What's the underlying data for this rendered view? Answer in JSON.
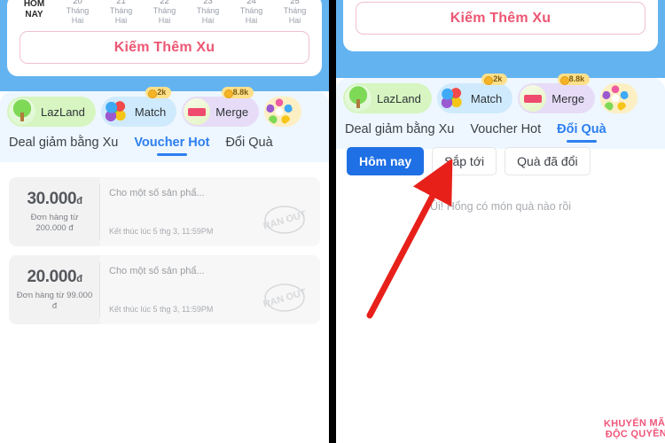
{
  "left_panel": {
    "date_strip": {
      "today_label_line1": "HÔM",
      "today_label_line2": "NAY",
      "dates": [
        {
          "num": "20",
          "month_line1": "Tháng",
          "month_line2": "Hai"
        },
        {
          "num": "21",
          "month_line1": "Tháng",
          "month_line2": "Hai"
        },
        {
          "num": "22",
          "month_line1": "Tháng",
          "month_line2": "Hai"
        },
        {
          "num": "23",
          "month_line1": "Tháng",
          "month_line2": "Hai"
        },
        {
          "num": "24",
          "month_line1": "Tháng",
          "month_line2": "Hai"
        },
        {
          "num": "25",
          "month_line1": "Tháng",
          "month_line2": "Hai"
        }
      ]
    },
    "earn_button_label": "Kiếm Thêm Xu",
    "games": [
      {
        "label": "LazLand",
        "icon": "tree-icon",
        "badge": null
      },
      {
        "label": "Match",
        "icon": "balls-icon",
        "badge": "2k"
      },
      {
        "label": "Merge",
        "icon": "merge-icon",
        "badge": "8.8k"
      },
      {
        "label": "",
        "icon": "flower-icon",
        "badge": null
      }
    ],
    "tabs": [
      {
        "label": "Deal giảm bằng Xu",
        "active": false
      },
      {
        "label": "Voucher Hot",
        "active": true
      },
      {
        "label": "Đổi Quà",
        "active": false
      }
    ],
    "vouchers": [
      {
        "amount": "30.000",
        "currency": "đ",
        "condition_line1": "Đơn hàng từ",
        "condition_line2": "200.000 đ",
        "title": "Cho một số sản phẩ...",
        "expiry": "Kết thúc lúc 5 thg 3, 11:59PM",
        "stamp": "RAN OUT"
      },
      {
        "amount": "20.000",
        "currency": "đ",
        "condition_line1": "Đơn hàng từ 99.000",
        "condition_line2": "đ",
        "title": "Cho một số sản phẩ...",
        "expiry": "Kết thúc lúc 5 thg 3, 11:59PM",
        "stamp": "RAN OUT"
      }
    ]
  },
  "right_panel": {
    "earn_button_label": "Kiếm Thêm Xu",
    "games": [
      {
        "label": "LazLand",
        "icon": "tree-icon",
        "badge": null
      },
      {
        "label": "Match",
        "icon": "balls-icon",
        "badge": "2k"
      },
      {
        "label": "Merge",
        "icon": "merge-icon",
        "badge": "8.8k"
      },
      {
        "label": "",
        "icon": "flower-icon",
        "badge": null
      }
    ],
    "tabs": [
      {
        "label": "Deal giảm bằng Xu",
        "active": false
      },
      {
        "label": "Voucher Hot",
        "active": false
      },
      {
        "label": "Đổi Quà",
        "active": true
      }
    ],
    "subtabs": [
      {
        "label": "Hôm nay",
        "active": true
      },
      {
        "label": "Sắp tới",
        "active": false
      },
      {
        "label": "Quà đã đổi",
        "active": false
      }
    ],
    "empty_state_text": "Ủi! Hổng có món quà nào rồi"
  },
  "annotation": {
    "arrow_color": "#e8201a",
    "arrow_target": "Sắp tới"
  },
  "watermark": {
    "line1": "KHUYẾN MÃI",
    "line2": "ĐỘC QUYỀN",
    "color": "#f0557a"
  },
  "colors": {
    "brand_blue": "#63b3f0",
    "accent_blue": "#2d7ff0",
    "active_blue": "#1f6fe5",
    "pink_red": "#ed5673",
    "games_bg": "#eef7ff"
  }
}
